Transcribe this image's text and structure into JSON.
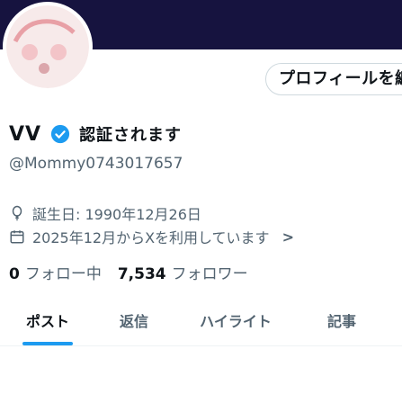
{
  "banner": {
    "color": "#16133f"
  },
  "profile": {
    "avatar_icon": "avatar-image",
    "edit_button_label": "プロフィールを編集",
    "display_name": "VV",
    "verified_label": "認証されます",
    "handle": "@Mommy0743017657",
    "birth_date": "誕生日: 1990年12月26日",
    "joined": "2025年12月からXを利用しています",
    "following_count": "0",
    "following_label": "フォロー中",
    "followers_count": "7,534",
    "followers_label": "フォロワー"
  },
  "tabs": [
    {
      "label": "ポスト"
    },
    {
      "label": "返信"
    },
    {
      "label": "ハイライト"
    },
    {
      "label": "記事"
    }
  ],
  "colors": {
    "accent": "#1d9bf0",
    "secondary_text": "#536471"
  }
}
